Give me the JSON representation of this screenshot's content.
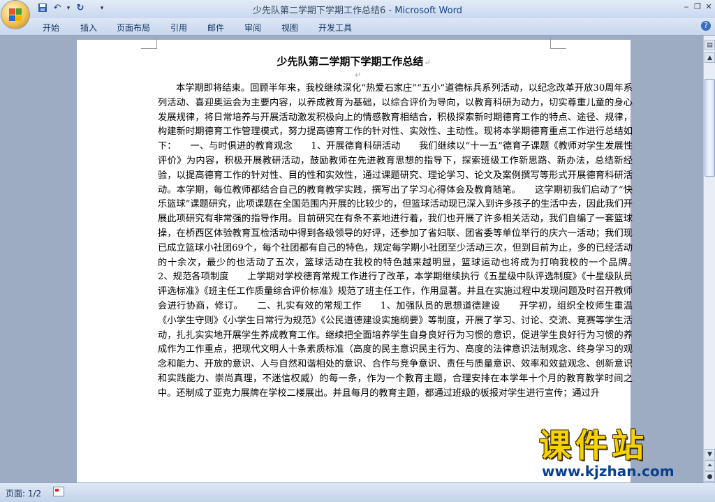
{
  "window": {
    "doc_name": "少先队第二学期下学期工作总结6",
    "separator": " - ",
    "app_name": "Microsoft Word"
  },
  "quick_access": [
    "save-icon",
    "undo-icon",
    "redo-icon",
    "customize-icon"
  ],
  "ribbon_tabs": [
    "开始",
    "插入",
    "页面布局",
    "引用",
    "邮件",
    "审阅",
    "视图",
    "开发工具"
  ],
  "document": {
    "title": "少先队第二学期下学期工作总结",
    "paragraph_mark": "↵",
    "body": "本学期即将结束。回顾半年来，我校继续深化“热爱石家庄”“五小”道德标兵系列活动，以纪念改革开放30周年系列活动、喜迎奥运会为主要内容，以养成教育为基础，以综合评价为导向，以教育科研为动力，切实尊重儿童的身心发展规律，将日常培养与开展活动激发积极向上的情感教育相结合，积极探索新时期德育工作的特点、途径、规律，构建新时期德育工作管理模式，努力提高德育工作的针对性、实效性、主动性。现将本学期德育重点工作进行总结如下：　　一、与时俱进的教育观念　　1、开展德育科研活动　　我们继续以“十一五”德育子课题《教师对学生发展性评价》为内容，积极开展教研活动，鼓励教师在先进教育思想的指导下，探索班级工作新思路、新办法，总结新经验，以提高德育工作的针对性、目的性和实效性，通过课题研究、理论学习、论文及案例撰写等形式开展德育科研活动。本学期，每位教师都结合自己的教育教学实践，撰写出了学习心得体会及教育随笔。　　这学期初我们启动了“快乐篮球”课题研究，此项课题在全国范围内开展的比较少的，但篮球活动现已深入到许多孩子的生活中去，因此我们开展此项研究有非常强的指导作用。目前研究在有条不紊地进行着，我们也开展了许多相关活动，我们自编了一套篮球操，在桥西区体验教育互检活动中得到各级领导的好评，还参加了省妇联、团省委等单位举行的庆六一活动；我们现已成立篮球小社团69个，每个社团都有自己的特色，规定每学期小社团至少活动三次，但到目前为止，多的已经活动的十余次，最少的也活动了五次，篮球活动在我校的特色越来越明显，篮球运动也将成为打响我校的一个品牌。　　2、规范各项制度　　上学期对学校德育常规工作进行了改革，本学期继续执行《五星级中队评选制度》《十星级队员评选标准》《班主任工作质量综合评价标准》规范了班主任工作，作用显著。并且在实施过程中发现问题及时召开教师会进行协商，修订。　　二、扎实有效的常规工作　　1、加强队员的思想道德建设　　开学初，组织全校师生重温《小学生守则》《小学生日常行为规范》《公民道德建设实施纲要》等制度，开展了学习、讨论、交流、竞赛等学生活动，扎扎实实地开展学生养成教育工作。继续把全面培养学生自身良好行为习惯的意识，促进学生良好行为习惯的养成作为工作重点，把现代文明人十条素质标准（高度的民主意识民主行为、高度的法律意识法制观念、终身学习的观念和能力、开放的意识、人与自然和谐相处的意识、合作与竞争意识、责任与质量意识、效率和效益观念、创新意识和实践能力、崇尚真理，不迷信权威）的每一条，作为一个教育主题，合理安排在本学年十个月的教育教学时间之中。还制成了亚克力展牌在学校二楼展出。并且每月的教育主题，都通过班级的板报对学生进行宣传；通过升"
  },
  "statusbar": {
    "page_label": "页面: 1/2"
  },
  "watermark": {
    "title": "课件站",
    "url": "www.kjzhan.com"
  }
}
